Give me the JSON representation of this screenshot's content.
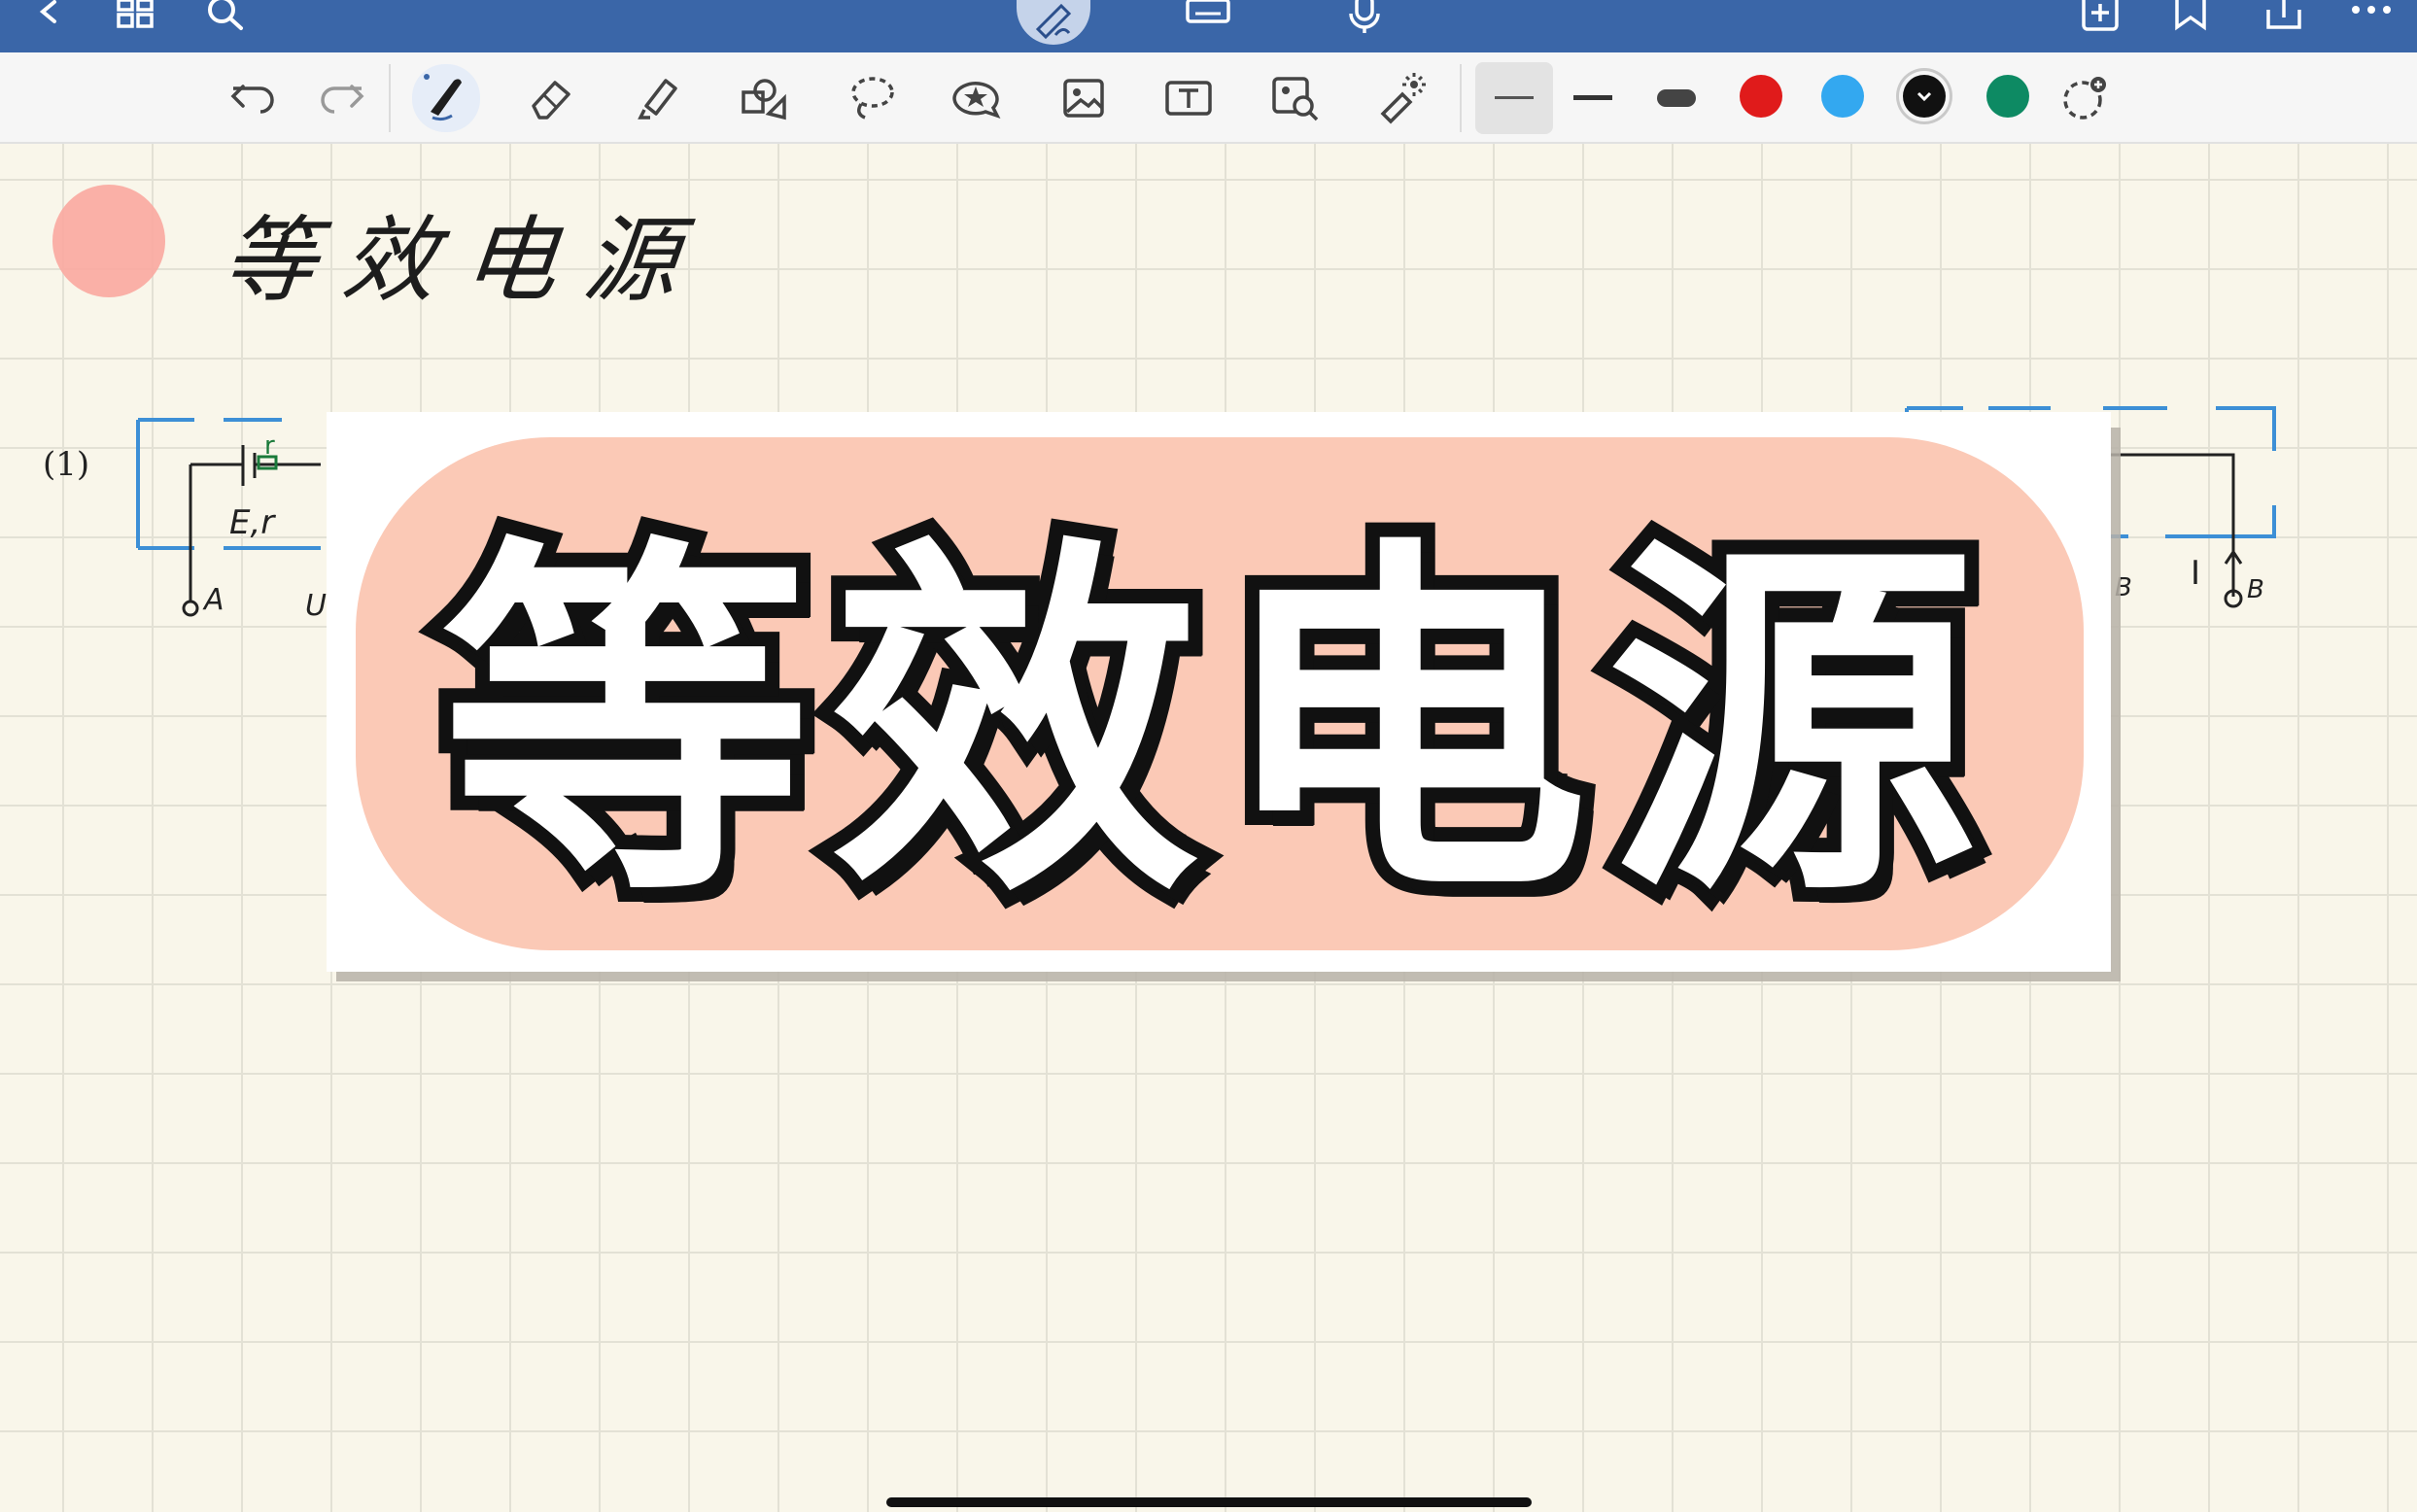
{
  "app": {
    "nav_icons": [
      "chevron-left-icon",
      "grid-icon",
      "search-icon",
      "pen-mode-icon",
      "keyboard-icon",
      "microphone-icon",
      "add-page-icon",
      "bookmark-icon",
      "share-icon",
      "more-icon"
    ]
  },
  "toolbar": {
    "tools": [
      "undo-icon",
      "redo-icon",
      "pen-icon",
      "eraser-icon",
      "highlighter-icon",
      "shapes-icon",
      "lasso-icon",
      "sticker-icon",
      "image-icon",
      "text-box-icon",
      "image-search-icon",
      "laser-pointer-icon"
    ],
    "active_tool": "pen-icon",
    "stroke_widths": [
      "thin",
      "medium",
      "thick"
    ],
    "active_width": "thin",
    "colors": [
      "#e01b1b",
      "#33a8f0",
      "#111111",
      "#0d8a63"
    ],
    "active_color": "#111111"
  },
  "canvas": {
    "heading": "等效电源",
    "circuit_labels": {
      "item_number": "(1)",
      "source": "E,r",
      "resistor": "r",
      "node_a": "A",
      "voltage": "U",
      "current": "I",
      "node_b": "B",
      "node_b_left": "B"
    }
  },
  "banner": {
    "text": "等效电源",
    "fill_color": "#ffffff",
    "outline_color": "#111111",
    "glow_color": "#fbc9b6"
  }
}
